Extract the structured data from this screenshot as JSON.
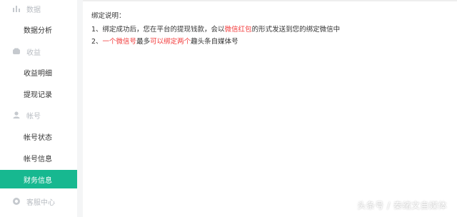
{
  "sidebar": {
    "sections": [
      {
        "label": "数据",
        "icon": "bar-chart-icon"
      },
      {
        "label": "收益",
        "icon": "wallet-icon"
      },
      {
        "label": "帐号",
        "icon": "user-icon"
      },
      {
        "label": "客服中心",
        "icon": "headset-icon"
      }
    ],
    "items": [
      {
        "label": "数据分析"
      },
      {
        "label": "收益明细"
      },
      {
        "label": "提现记录"
      },
      {
        "label": "帐号状态"
      },
      {
        "label": "帐号信息"
      },
      {
        "label": "财务信息",
        "active": true
      }
    ]
  },
  "main": {
    "heading": "绑定说明：",
    "line1": {
      "prefix": "1、绑定成功后，您在平台的提现钱款，会以",
      "highlight": "微信红包",
      "suffix": "的形式发送到您的绑定微信中"
    },
    "line2": {
      "prefix": "2、",
      "highlight1": "一个微信号",
      "middle": "最多",
      "highlight2": "可以绑定两个",
      "suffix": "趣头条自媒体号"
    }
  },
  "watermark": "头条号 / 秦绪文自媒体",
  "colors": {
    "accent": "#17b890",
    "highlight": "#f23a3a",
    "section_text": "#b8bcc2"
  }
}
